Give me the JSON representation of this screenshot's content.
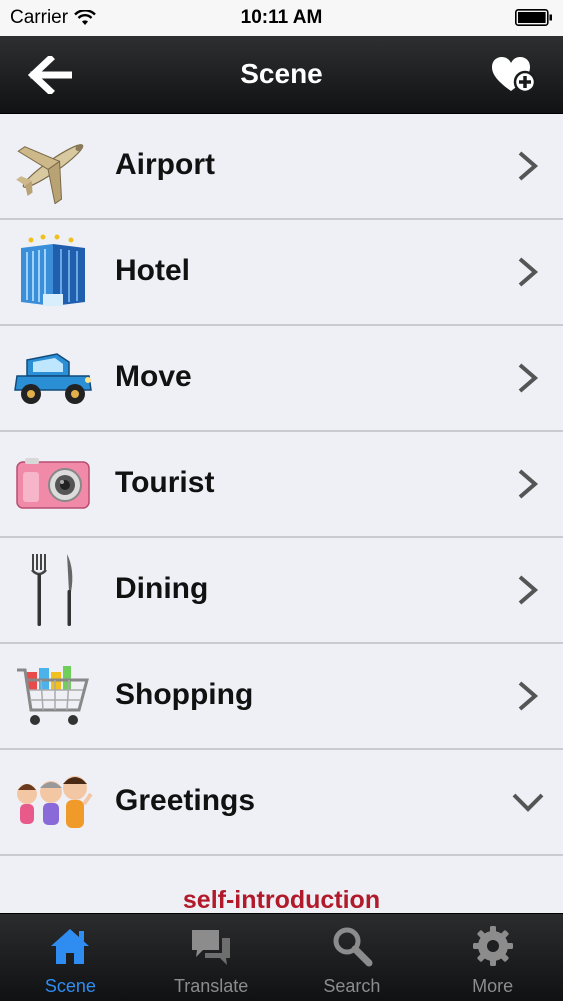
{
  "status_bar": {
    "carrier": "Carrier",
    "time": "10:11 AM"
  },
  "nav": {
    "title": "Scene",
    "back_icon": "arrow-left-icon",
    "favorite_icon": "heart-plus-icon"
  },
  "scenes": [
    {
      "label": "Airport",
      "icon": "airplane-icon",
      "expanded": false
    },
    {
      "label": "Hotel",
      "icon": "hotel-building-icon",
      "expanded": false
    },
    {
      "label": "Move",
      "icon": "car-icon",
      "expanded": false
    },
    {
      "label": "Tourist",
      "icon": "camera-icon",
      "expanded": false
    },
    {
      "label": "Dining",
      "icon": "fork-knife-icon",
      "expanded": false
    },
    {
      "label": "Shopping",
      "icon": "shopping-cart-icon",
      "expanded": false
    },
    {
      "label": "Greetings",
      "icon": "people-icon",
      "expanded": true
    }
  ],
  "greetings_items": [
    "self-introduction"
  ],
  "tabs": [
    {
      "label": "Scene",
      "icon": "home-icon",
      "active": true
    },
    {
      "label": "Translate",
      "icon": "chat-bubbles-icon",
      "active": false
    },
    {
      "label": "Search",
      "icon": "magnifier-icon",
      "active": false
    },
    {
      "label": "More",
      "icon": "gear-icon",
      "active": false
    }
  ],
  "colors": {
    "active_tab": "#2f8df2",
    "inactive_tab": "#8c8c8c",
    "sub_item": "#b01a2a",
    "list_bg": "#eef0f6"
  }
}
